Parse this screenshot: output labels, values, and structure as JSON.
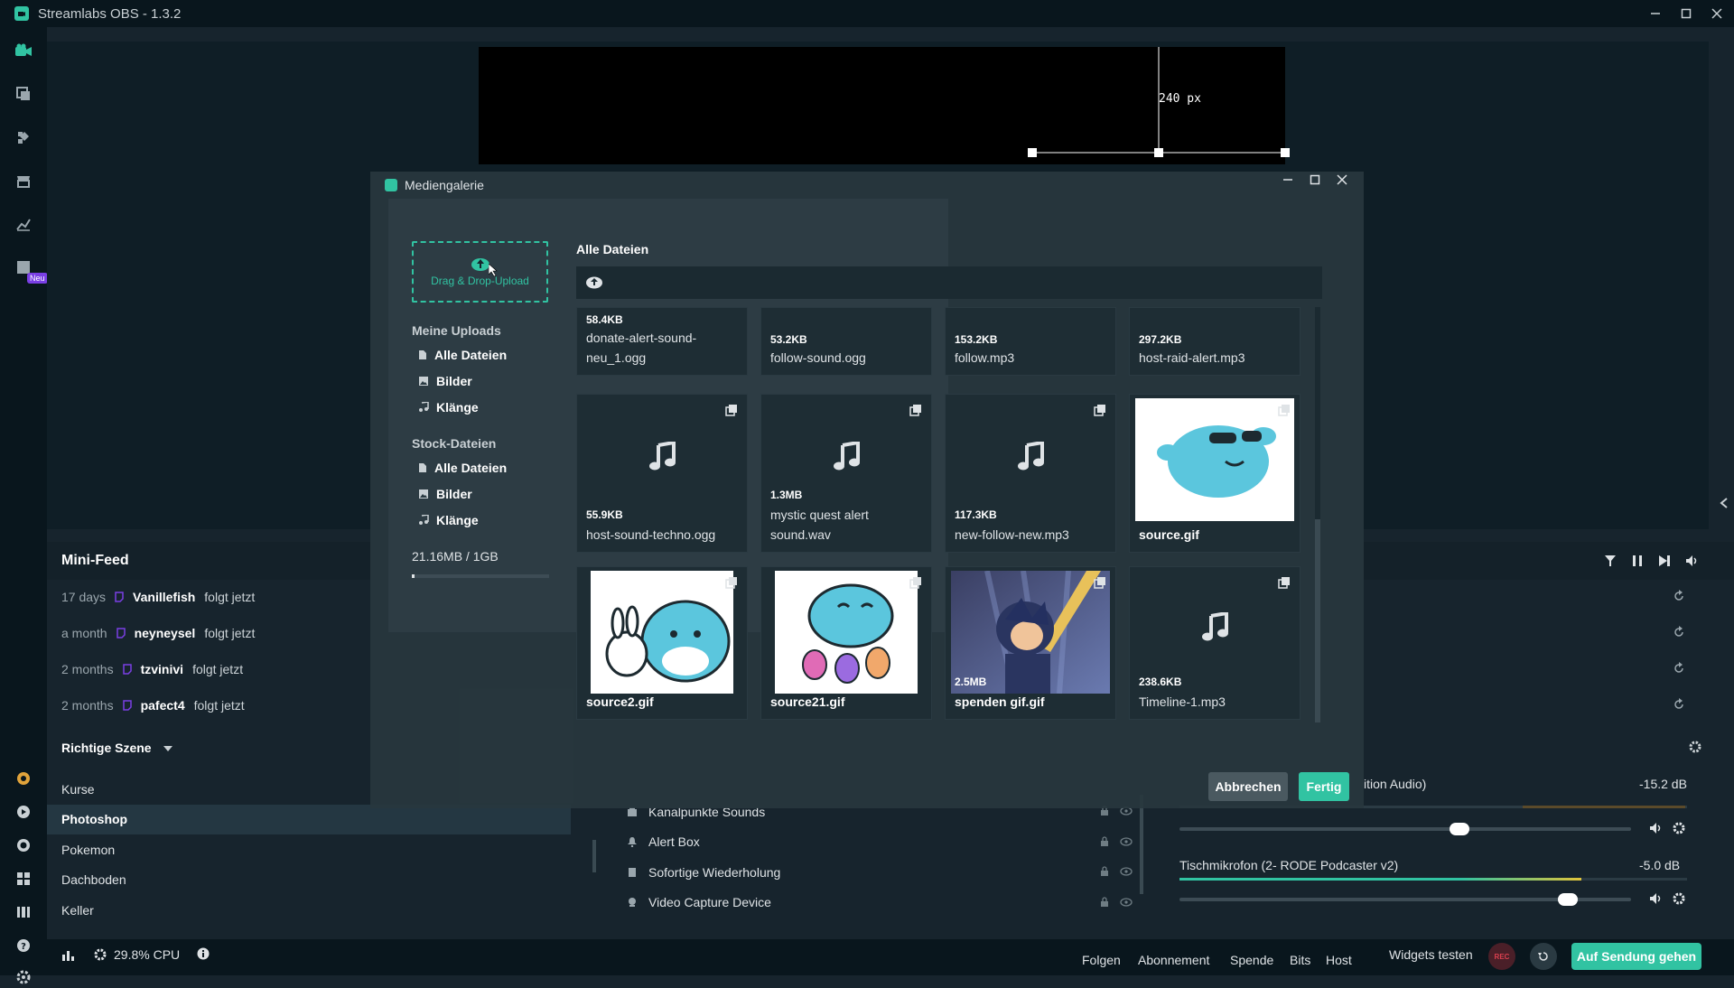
{
  "app": {
    "title": "Streamlabs OBS - 1.3.2"
  },
  "nav": {
    "new_badge": "Neu"
  },
  "preview": {
    "size_label": "240 px"
  },
  "minifeed": {
    "title": "Mini-Feed",
    "rows": [
      {
        "time": "17 days",
        "name": "Vanillefish",
        "action": "folgt jetzt"
      },
      {
        "time": "a month",
        "name": "neyneysel",
        "action": "folgt jetzt"
      },
      {
        "time": "2 months",
        "name": "tzvinivi",
        "action": "folgt jetzt"
      },
      {
        "time": "2 months",
        "name": "pafect4",
        "action": "folgt jetzt"
      }
    ]
  },
  "scenes": {
    "title": "Richtige Szene",
    "items": [
      "Kurse",
      "Photoshop",
      "Pokemon",
      "Dachboden",
      "Keller"
    ],
    "active_index": 1
  },
  "sources": {
    "items": [
      "Kanalpunkte Sounds",
      "Alert Box",
      "Sofortige Wiederholung",
      "Video Capture Device"
    ]
  },
  "mixer": {
    "channels": [
      {
        "name": "ition Audio)",
        "db": "-15.2 dB",
        "level": 0.62
      },
      {
        "name": "Tischmikrofon (2- RODE Podcaster v2)",
        "db": "-5.0 dB",
        "level": 0.86
      }
    ]
  },
  "bottombar": {
    "cpu": "29.8% CPU",
    "links": [
      "Folgen",
      "Abonnement",
      "Spende",
      "Bits",
      "Host"
    ],
    "test_widgets": "Widgets testen",
    "rec": "REC",
    "go_live": "Auf Sendung gehen"
  },
  "gallery": {
    "title": "Mediengalerie",
    "dropzone_label": "Drag & Drop-Upload",
    "my_uploads": "Meine Uploads",
    "stock": "Stock-Dateien",
    "filters": [
      "Alle Dateien",
      "Bilder",
      "Klänge"
    ],
    "usage": "21.16MB / 1GB",
    "usage_fraction": 0.021,
    "all_files_title": "Alle Dateien",
    "cancel": "Abbrechen",
    "done": "Fertig",
    "files": [
      {
        "size": "58.4KB",
        "name": "donate-alert-sound-neu_1.ogg",
        "type": "sound"
      },
      {
        "size": "53.2KB",
        "name": "follow-sound.ogg",
        "type": "sound"
      },
      {
        "size": "153.2KB",
        "name": "follow.mp3",
        "type": "sound"
      },
      {
        "size": "297.2KB",
        "name": "host-raid-alert.mp3",
        "type": "sound"
      },
      {
        "size": "55.9KB",
        "name": "host-sound-techno.ogg",
        "type": "sound"
      },
      {
        "size": "1.3MB",
        "name": "mystic quest alert sound.wav",
        "type": "sound"
      },
      {
        "size": "117.3KB",
        "name": "new-follow-new.mp3",
        "type": "sound"
      },
      {
        "size": "",
        "name": "source.gif",
        "type": "image"
      },
      {
        "size": "",
        "name": "source2.gif",
        "type": "image"
      },
      {
        "size": "",
        "name": "source21.gif",
        "type": "image"
      },
      {
        "size": "2.5MB",
        "name": "spenden gif.gif",
        "type": "image"
      },
      {
        "size": "238.6KB",
        "name": "Timeline-1.mp3",
        "type": "sound"
      }
    ]
  },
  "colors": {
    "accent": "#31c3a2",
    "background": "#17242d",
    "panel": "#09161d",
    "rec": "#d9404f"
  }
}
